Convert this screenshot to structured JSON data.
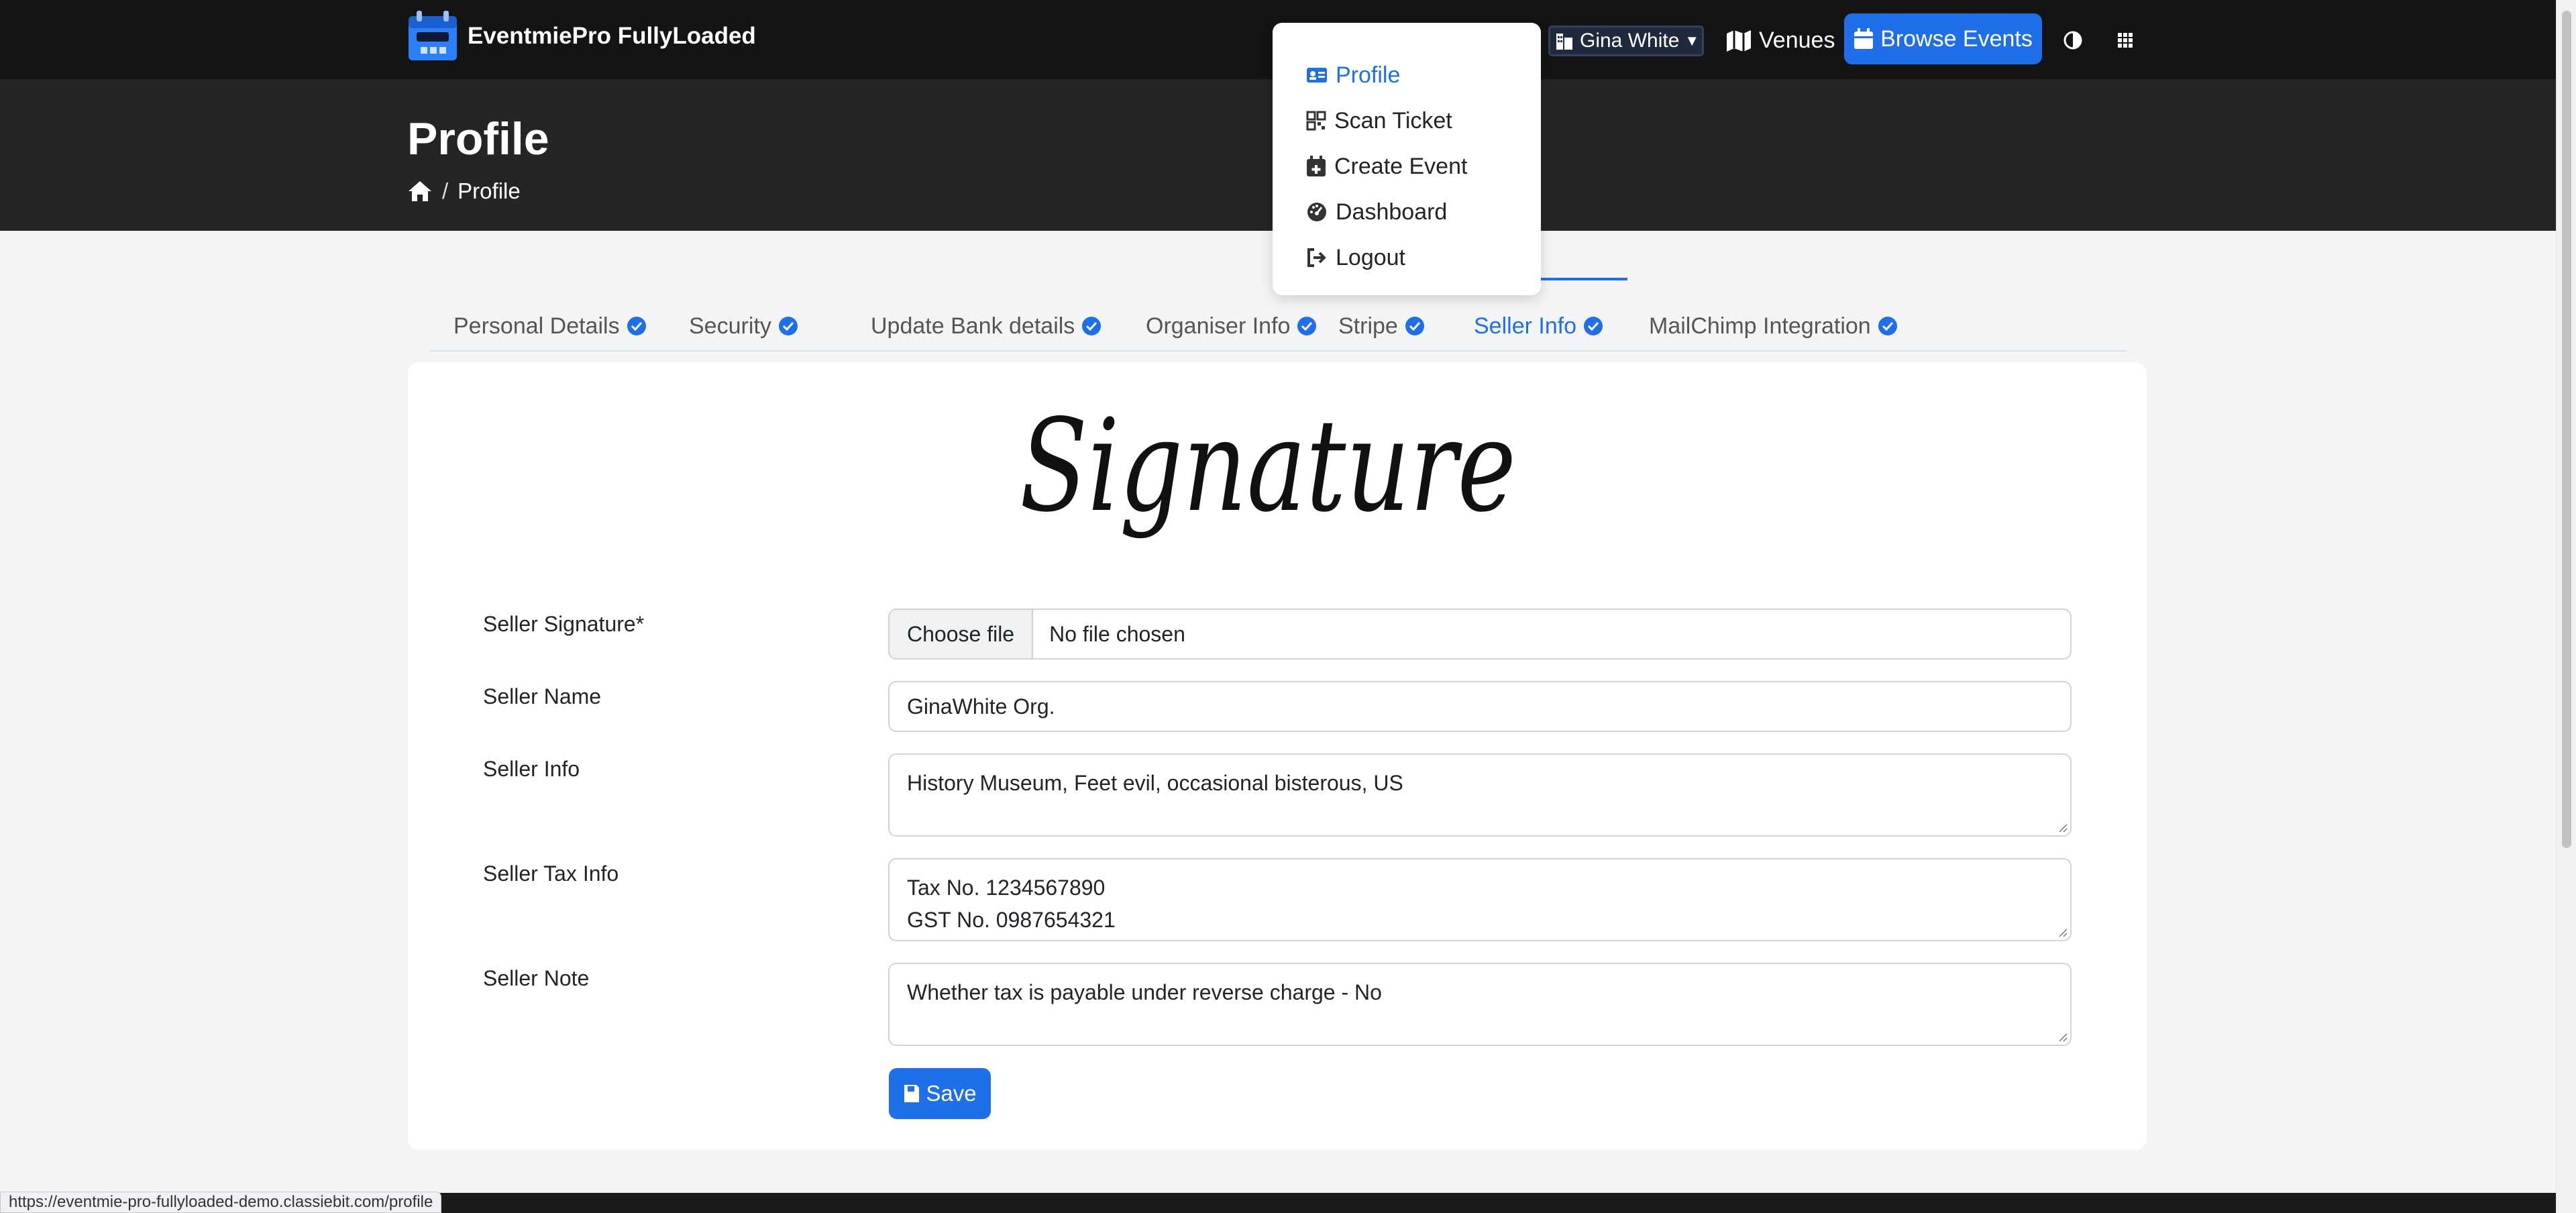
{
  "app": {
    "name": "EventmiePro FullyLoaded"
  },
  "nav": {
    "user_name": "Gina White",
    "venues": "Venues",
    "browse_events": "Browse Events"
  },
  "user_menu": [
    {
      "label": "Profile",
      "icon": "id-card-icon",
      "active": true
    },
    {
      "label": "Scan Ticket",
      "icon": "qrcode-icon"
    },
    {
      "label": "Create Event",
      "icon": "calendar-plus-icon"
    },
    {
      "label": "Dashboard",
      "icon": "gauge-icon"
    },
    {
      "label": "Logout",
      "icon": "logout-icon"
    }
  ],
  "page": {
    "title": "Profile",
    "breadcrumb": [
      "Profile"
    ]
  },
  "tabs": [
    {
      "label": "Personal Details"
    },
    {
      "label": "Security"
    },
    {
      "label": "Update Bank details"
    },
    {
      "label": "Organiser Info"
    },
    {
      "label": "Stripe"
    },
    {
      "label": "Seller Info",
      "active": true
    },
    {
      "label": "MailChimp Integration"
    }
  ],
  "form": {
    "signature_text": "Signature",
    "seller_signature_label": "Seller Signature*",
    "choose_file": "Choose file",
    "no_file": "No file chosen",
    "seller_name_label": "Seller Name",
    "seller_name_value": "GinaWhite Org.",
    "seller_info_label": "Seller Info",
    "seller_info_value": "History Museum, Feet evil, occasional bisterous, US",
    "seller_tax_label": "Seller Tax Info",
    "seller_tax_line1": "Tax No. 1234567890",
    "seller_tax_line2": "GST No. 0987654321",
    "seller_note_label": "Seller Note",
    "seller_note_value": "Whether tax is payable under reverse charge - No",
    "save": "Save"
  },
  "status_bar": {
    "url": "https://eventmie-pro-fullyloaded-demo.classiebit.com/profile"
  },
  "colors": {
    "accent": "#1f6feb",
    "topbar": "#141414",
    "header": "#252525"
  }
}
